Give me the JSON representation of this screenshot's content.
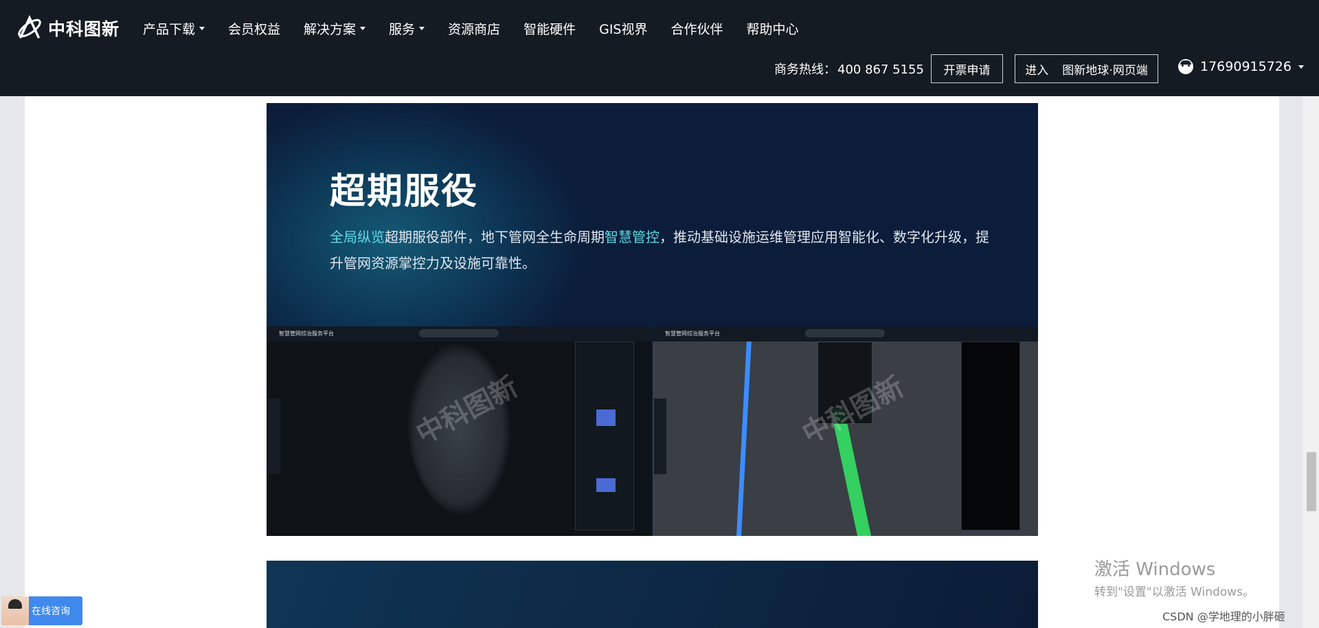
{
  "header": {
    "brand": "中科图新",
    "nav": [
      {
        "label": "产品下载",
        "dropdown": true
      },
      {
        "label": "会员权益",
        "dropdown": false
      },
      {
        "label": "解决方案",
        "dropdown": true
      },
      {
        "label": "服务",
        "dropdown": true
      },
      {
        "label": "资源商店",
        "dropdown": false
      },
      {
        "label": "智能硬件",
        "dropdown": false
      },
      {
        "label": "GIS视界",
        "dropdown": false
      },
      {
        "label": "合作伙伴",
        "dropdown": false
      },
      {
        "label": "帮助中心",
        "dropdown": false
      }
    ],
    "hotline_label": "商务热线：",
    "hotline_number": "400 867 5155",
    "invoice_button": "开票申请",
    "enter_prefix": "进入",
    "enter_target": "图新地球·网页端",
    "user_phone": "17690915726"
  },
  "feature": {
    "title": "超期服役",
    "desc_hl1": "全局纵览",
    "desc_part1": "超期服役部件，地下管网全生命周期",
    "desc_hl2": "智慧管控",
    "desc_part2": "，推动基础设施运维管理应用智能化、数字化升级，提升管网资源掌控力及设施可靠性。",
    "screenshot_title": "智慧管网综治服务平台",
    "watermark": "中科图新"
  },
  "consult": {
    "label": "在线咨询"
  },
  "windows": {
    "title": "激活 Windows",
    "subtitle": "转到\"设置\"以激活 Windows。"
  },
  "footer_credit": "CSDN @学地理的小胖砸",
  "colors": {
    "header_bg": "#151b22",
    "accent": "#5fd9e4",
    "consult_bg": "#3f89ec"
  }
}
